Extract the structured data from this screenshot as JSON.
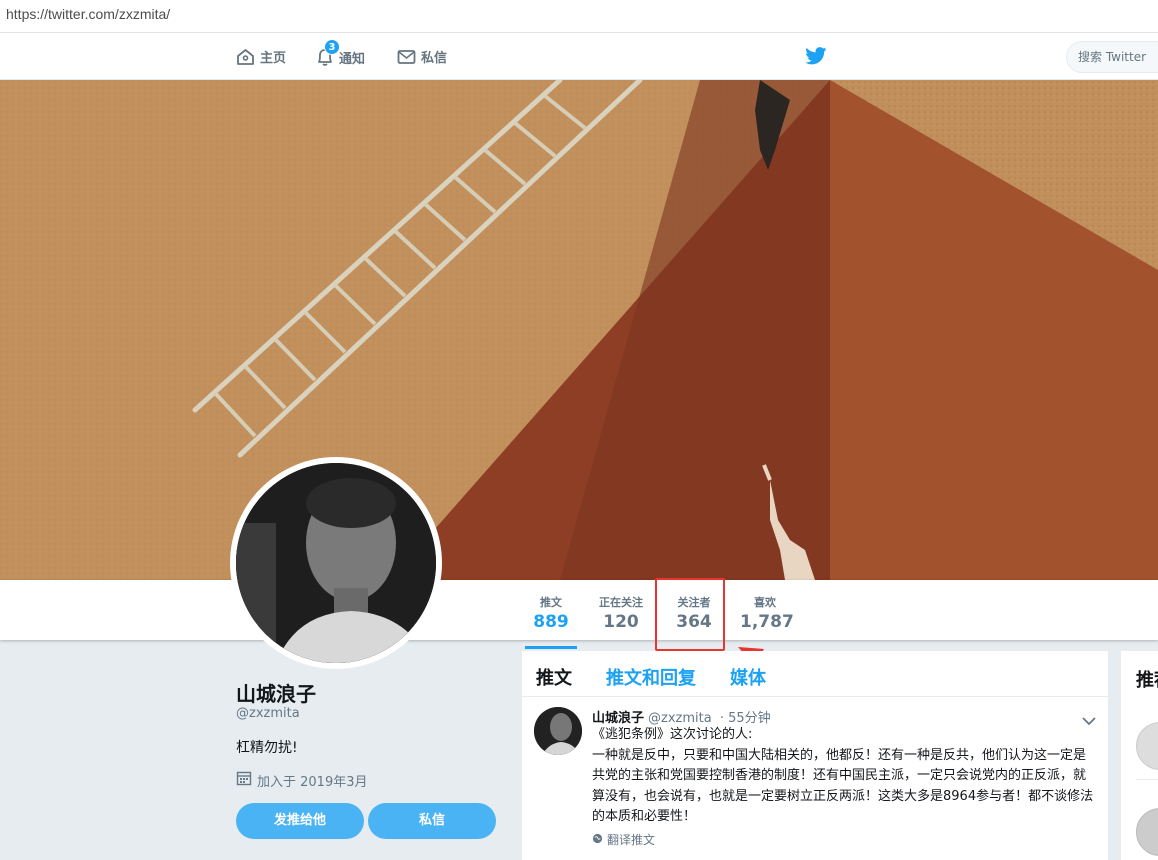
{
  "browser": {
    "url": "https://twitter.com/zxzmita/"
  },
  "nav": {
    "home_label": "主页",
    "notifications_label": "通知",
    "notifications_badge": "3",
    "messages_label": "私信",
    "search_placeholder": "搜索 Twitter"
  },
  "profile_nav": {
    "stats": [
      {
        "label": "推文",
        "value": "889"
      },
      {
        "label": "正在关注",
        "value": "120"
      },
      {
        "label": "关注者",
        "value": "364"
      },
      {
        "label": "喜欢",
        "value": "1,787"
      }
    ]
  },
  "profile": {
    "name": "山城浪子",
    "handle": "@zxzmita",
    "bio": "杠精勿扰!",
    "joined": "加入于 2019年3月",
    "tweet_to_button": "发推给他",
    "message_button": "私信"
  },
  "timeline": {
    "tabs": [
      "推文",
      "推文和回复",
      "媒体"
    ],
    "tweet": {
      "name": "山城浪子",
      "handle": "@zxzmita",
      "time": "· 55分钟",
      "text": "《逃犯条例》这次讨论的人:\n一种就是反中，只要和中国大陆相关的，他都反！还有一种是反共，他们认为这一定是共党的主张和党国要控制香港的制度！还有中国民主派，一定只会说党内的正反派，就算没有，也会说有，也就是一定要树立正反两派！这类大多是8964参与者！都不谈修法的本质和必要性！",
      "translate": "翻译推文"
    }
  },
  "right_panel": {
    "title": "推荐"
  },
  "colors": {
    "accent": "#1da1f2",
    "annotation": "#e8352e"
  }
}
